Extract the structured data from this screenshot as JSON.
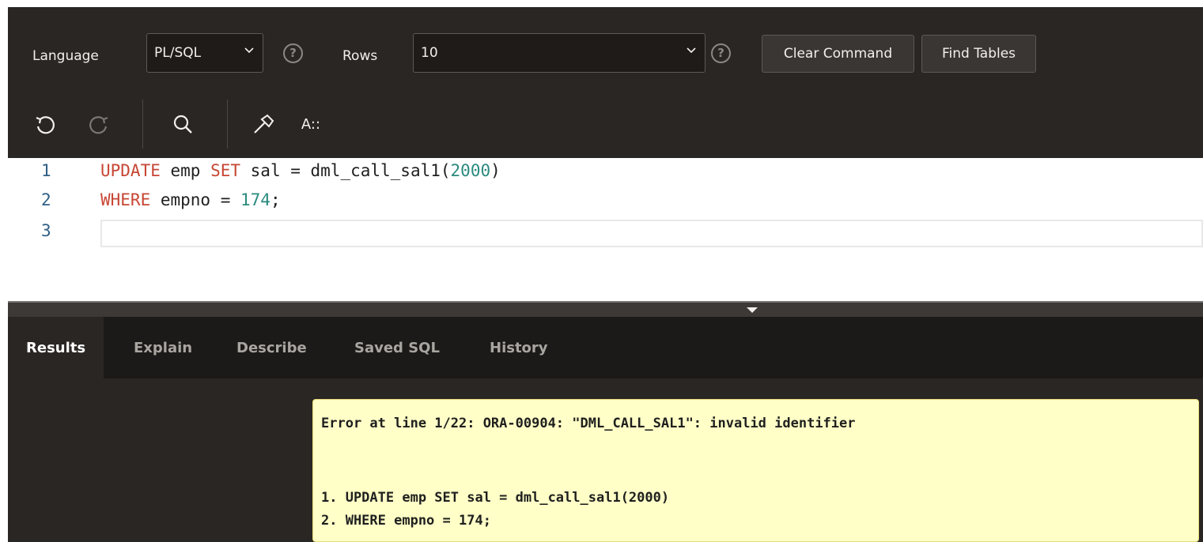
{
  "toolbar": {
    "language_label": "Language",
    "language_value": "PL/SQL",
    "rows_label": "Rows",
    "rows_value": "10",
    "help_glyph": "?",
    "clear_command": "Clear Command",
    "find_tables": "Find Tables"
  },
  "icons": [
    "undo-icon",
    "redo-icon",
    "search-icon",
    "hammer-icon",
    "autocomplete-icon"
  ],
  "autocomplete_label": "A::",
  "editor": {
    "lines": [
      {
        "num": "1"
      },
      {
        "num": "2"
      },
      {
        "num": "3"
      }
    ],
    "line1": {
      "kw1": "UPDATE",
      "t1": " emp ",
      "kw2": "SET",
      "t2": " sal = dml_call_sal1(",
      "n1": "2000",
      "t3": ")"
    },
    "line2": {
      "kw1": "WHERE",
      "t1": " empno = ",
      "n1": "174",
      "t2": ";"
    }
  },
  "tabs": [
    "Results",
    "Explain",
    "Describe",
    "Saved SQL",
    "History"
  ],
  "error": {
    "message": "Error at line 1/22: ORA-00904: \"DML_CALL_SAL1\": invalid identifier",
    "stmt1": "1. UPDATE emp SET sal = dml_call_sal1(2000)",
    "stmt2": "2. WHERE empno = 174;"
  },
  "colors": {
    "toolbar_bg": "#2a2623",
    "keyword": "#c74634",
    "number": "#2a8a7f",
    "error_bg": "#ffffc7"
  }
}
